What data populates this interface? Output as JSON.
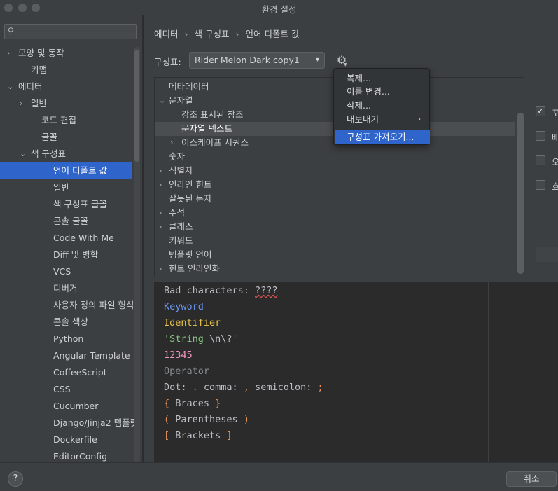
{
  "window": {
    "title": "환경 설정"
  },
  "search": {
    "placeholder": "",
    "value": ""
  },
  "icons": {
    "search": "search-icon",
    "gear": "gear-icon",
    "help": "help-icon"
  },
  "sidebar": {
    "items": [
      {
        "label": "모양 및 동작",
        "arrow": "›"
      },
      {
        "label": "키맵",
        "arrow": ""
      },
      {
        "label": "에디터",
        "arrow": "⌄"
      },
      {
        "label": "일반",
        "arrow": "›"
      },
      {
        "label": "코드 편집",
        "arrow": ""
      },
      {
        "label": "글꼴",
        "arrow": ""
      },
      {
        "label": "색 구성표",
        "arrow": "⌄"
      },
      {
        "label": "언어 디폴트 값",
        "arrow": ""
      },
      {
        "label": "일반",
        "arrow": ""
      },
      {
        "label": "색 구성표 글꼴",
        "arrow": ""
      },
      {
        "label": "콘솔 글꼴",
        "arrow": ""
      },
      {
        "label": "Code With Me",
        "arrow": ""
      },
      {
        "label": "Diff 및 병합",
        "arrow": ""
      },
      {
        "label": "VCS",
        "arrow": ""
      },
      {
        "label": "디버거",
        "arrow": ""
      },
      {
        "label": "사용자 정의 파일 형식",
        "arrow": ""
      },
      {
        "label": "콘솔 색상",
        "arrow": ""
      },
      {
        "label": "Python",
        "arrow": ""
      },
      {
        "label": "Angular Template",
        "arrow": ""
      },
      {
        "label": "CoffeeScript",
        "arrow": ""
      },
      {
        "label": "CSS",
        "arrow": ""
      },
      {
        "label": "Cucumber",
        "arrow": ""
      },
      {
        "label": "Django/Jinja2 템플릿",
        "arrow": ""
      },
      {
        "label": "Dockerfile",
        "arrow": ""
      },
      {
        "label": "EditorConfig",
        "arrow": ""
      }
    ]
  },
  "breadcrumb": {
    "part1": "에디터",
    "part2": "색 구성표",
    "part3": "언어 디폴트 값",
    "sep": "›"
  },
  "scheme": {
    "label": "구성표:",
    "value": "Rider Melon Dark copy1",
    "caret": "▾"
  },
  "categories": [
    {
      "label": "메타데이터",
      "arrow": ""
    },
    {
      "label": "문자열",
      "arrow": "⌄"
    },
    {
      "label": "강조 표시된 참조",
      "arrow": ""
    },
    {
      "label": "문자열 텍스트",
      "arrow": ""
    },
    {
      "label": "이스케이프 시퀀스",
      "arrow": "›"
    },
    {
      "label": "숫자",
      "arrow": ""
    },
    {
      "label": "식별자",
      "arrow": "›"
    },
    {
      "label": "인라인 힌트",
      "arrow": "›"
    },
    {
      "label": "잘못된 문자",
      "arrow": ""
    },
    {
      "label": "주석",
      "arrow": "›"
    },
    {
      "label": "클래스",
      "arrow": "›"
    },
    {
      "label": "키워드",
      "arrow": ""
    },
    {
      "label": "템플릿 언어",
      "arrow": ""
    },
    {
      "label": "힌트 인라인화",
      "arrow": "›"
    }
  ],
  "options": [
    {
      "label": "포",
      "checked": true,
      "mark": "✓"
    },
    {
      "label": "배",
      "checked": false,
      "mark": ""
    },
    {
      "label": "오",
      "checked": false,
      "mark": ""
    },
    {
      "label": "효",
      "checked": false,
      "mark": ""
    }
  ],
  "popup": {
    "items": [
      {
        "label": "복제...",
        "submenu": ""
      },
      {
        "label": "이름 변경...",
        "submenu": ""
      },
      {
        "label": "삭제...",
        "submenu": ""
      },
      {
        "label": "내보내기",
        "submenu": "›"
      },
      {
        "label": "구성표 가져오기...",
        "submenu": ""
      }
    ]
  },
  "preview": {
    "bad_prefix": "Bad characters: ",
    "bad_chars": "????",
    "keyword": "Keyword",
    "identifier": "Identifier",
    "string_a": "'String ",
    "string_b": "\\n\\?",
    "string_c": "'",
    "number": "12345",
    "operator": "Operator",
    "dot_prefix": "Dot: ",
    "dot": ".",
    "comma_label": " comma: ",
    "comma": ",",
    "semi_label": " semicolon: ",
    "semi": ";",
    "brace_open": "{",
    "braces": " Braces ",
    "brace_close": "}",
    "paren_open": "(",
    "parens": " Parentheses ",
    "paren_close": ")",
    "bracket_open": "[",
    "brackets": " Brackets ",
    "bracket_close": "]"
  },
  "footer": {
    "help": "?",
    "cancel": "취소"
  }
}
